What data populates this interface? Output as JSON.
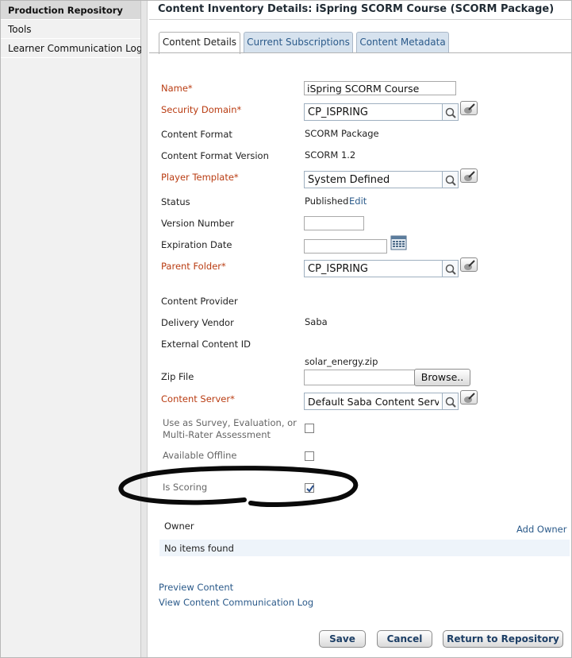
{
  "sidebar": {
    "items": [
      {
        "label": "Production Repository"
      },
      {
        "label": "Tools"
      },
      {
        "label": "Learner Communication Log"
      }
    ]
  },
  "header": {
    "title": "Content Inventory Details: iSpring SCORM Course (SCORM Package)"
  },
  "tabs": [
    {
      "label": "Content Details",
      "active": true
    },
    {
      "label": "Current Subscriptions",
      "active": false
    },
    {
      "label": "Content Metadata",
      "active": false
    }
  ],
  "form": {
    "name": {
      "label": "Name*",
      "value": "iSpring SCORM Course"
    },
    "security_domain": {
      "label": "Security Domain*",
      "value": "CP_ISPRING"
    },
    "content_format": {
      "label": "Content Format",
      "value": "SCORM Package"
    },
    "content_format_version": {
      "label": "Content Format Version",
      "value": "SCORM 1.2"
    },
    "player_template": {
      "label": "Player Template*",
      "value": "System Defined"
    },
    "status": {
      "label": "Status",
      "value": "Published",
      "edit_link": "Edit"
    },
    "version_number": {
      "label": "Version Number",
      "value": ""
    },
    "expiration_date": {
      "label": "Expiration Date",
      "value": ""
    },
    "parent_folder": {
      "label": "Parent Folder*",
      "value": "CP_ISPRING"
    },
    "content_provider": {
      "label": "Content Provider",
      "value": ""
    },
    "delivery_vendor": {
      "label": "Delivery Vendor",
      "value": "Saba"
    },
    "external_content_id": {
      "label": "External Content ID",
      "value": ""
    },
    "zip_file": {
      "label": "Zip File",
      "current_file": "solar_energy.zip",
      "browse_label": "Browse.."
    },
    "content_server": {
      "label": "Content Server*",
      "value": "Default Saba Content Server"
    },
    "use_as_survey": {
      "label_line1": "Use as Survey, Evaluation, or",
      "label_line2": "Multi-Rater Assessment",
      "checked": false
    },
    "available_offline": {
      "label": "Available Offline",
      "checked": false
    },
    "is_scoring": {
      "label": "Is Scoring",
      "checked": true
    }
  },
  "owner": {
    "heading": "Owner",
    "add_link": "Add Owner",
    "empty_text": "No items found"
  },
  "links": {
    "preview": "Preview Content",
    "communication_log": "View Content Communication Log"
  },
  "buttons": {
    "save": "Save",
    "cancel": "Cancel",
    "return": "Return to Repository"
  },
  "colors": {
    "required_label": "#b93c12",
    "link": "#2b5a8a",
    "button_text": "#1d3f66",
    "tab_inactive_bg": "#d6e2ee"
  }
}
